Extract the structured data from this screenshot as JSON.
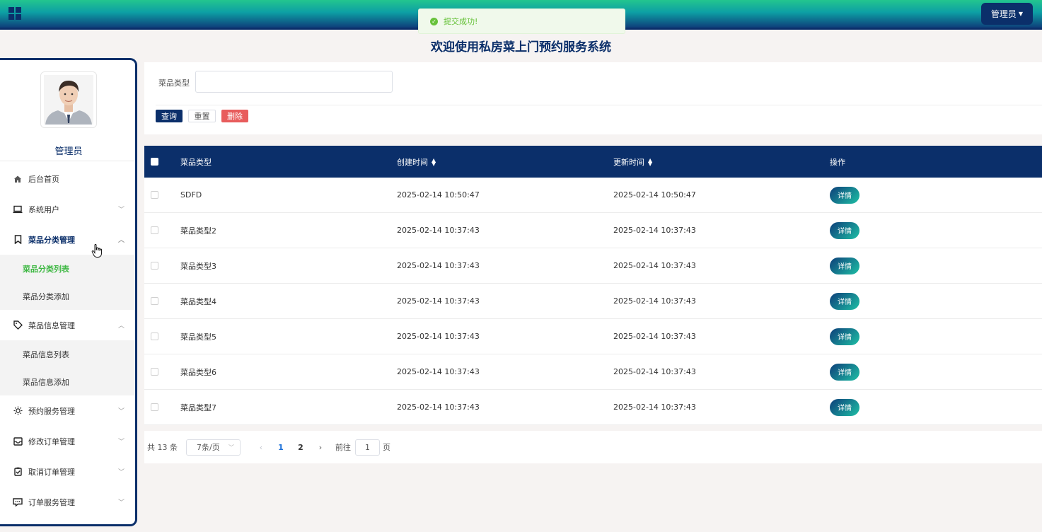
{
  "header": {
    "admin_label": "管理员",
    "page_title": "欢迎使用私房菜上门预约服务系统"
  },
  "toast": {
    "message": "提交成功!"
  },
  "sidebar": {
    "user_name": "管理员",
    "items": [
      {
        "label": "后台首页",
        "icon": "home-icon"
      },
      {
        "label": "系统用户",
        "icon": "laptop-icon"
      },
      {
        "label": "菜品分类管理",
        "icon": "bookmark-icon"
      },
      {
        "label": "菜品信息管理",
        "icon": "tag-icon"
      },
      {
        "label": "预约服务管理",
        "icon": "sun-icon"
      },
      {
        "label": "修改订单管理",
        "icon": "inbox-icon"
      },
      {
        "label": "取消订单管理",
        "icon": "clipboard-check-icon"
      },
      {
        "label": "订单服务管理",
        "icon": "chat-icon"
      }
    ],
    "category_sub": [
      "菜品分类列表",
      "菜品分类添加"
    ],
    "dish_sub": [
      "菜品信息列表",
      "菜品信息添加"
    ]
  },
  "search": {
    "label": "菜品类型",
    "value": "",
    "query_label": "查询",
    "reset_label": "重置",
    "delete_label": "删除"
  },
  "table": {
    "columns": [
      "菜品类型",
      "创建时间",
      "更新时间",
      "操作"
    ],
    "detail_label": "详情",
    "rows": [
      {
        "type": "SDFD",
        "created": "2025-02-14 10:50:47",
        "updated": "2025-02-14 10:50:47"
      },
      {
        "type": "菜品类型2",
        "created": "2025-02-14 10:37:43",
        "updated": "2025-02-14 10:37:43"
      },
      {
        "type": "菜品类型3",
        "created": "2025-02-14 10:37:43",
        "updated": "2025-02-14 10:37:43"
      },
      {
        "type": "菜品类型4",
        "created": "2025-02-14 10:37:43",
        "updated": "2025-02-14 10:37:43"
      },
      {
        "type": "菜品类型5",
        "created": "2025-02-14 10:37:43",
        "updated": "2025-02-14 10:37:43"
      },
      {
        "type": "菜品类型6",
        "created": "2025-02-14 10:37:43",
        "updated": "2025-02-14 10:37:43"
      },
      {
        "type": "菜品类型7",
        "created": "2025-02-14 10:37:43",
        "updated": "2025-02-14 10:37:43"
      }
    ]
  },
  "pagination": {
    "total": "共 13 条",
    "page_size": "7条/页",
    "pages": [
      "1",
      "2"
    ],
    "goto_label": "前往",
    "goto_value": "1",
    "unit": "页"
  },
  "colors": {
    "primary": "#0b2f6a",
    "active": "#3fb844",
    "danger": "#e85c5c",
    "success": "#67c23a"
  }
}
